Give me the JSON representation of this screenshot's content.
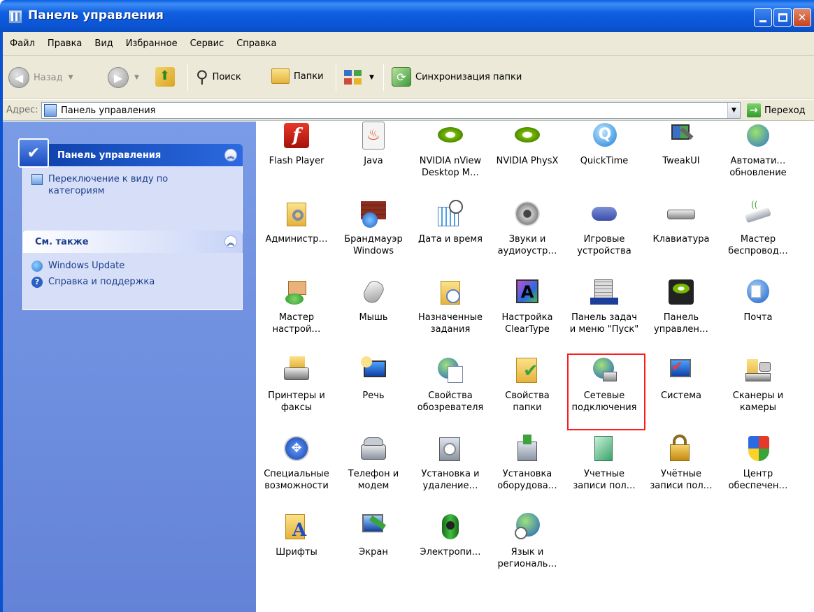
{
  "window": {
    "title": "Панель управления"
  },
  "menu": [
    "Файл",
    "Правка",
    "Вид",
    "Избранное",
    "Сервис",
    "Справка"
  ],
  "toolbar": {
    "back": "Назад",
    "search": "Поиск",
    "folders": "Папки",
    "sync": "Синхронизация папки"
  },
  "address": {
    "label": "Адрес:",
    "value": "Панель управления",
    "go": "Переход"
  },
  "sidebar": {
    "control_panel": {
      "title": "Панель управления",
      "link": "Переключение к виду по\nкатегориям"
    },
    "see_also": {
      "title": "См. также",
      "links": [
        "Windows Update",
        "Справка и поддержка"
      ]
    }
  },
  "items": [
    {
      "label": "Flash Player",
      "icon": "flash-icon"
    },
    {
      "label": "Java",
      "icon": "java-icon"
    },
    {
      "label": "NVIDIA nView\nDesktop M…",
      "icon": "nvidia-icon"
    },
    {
      "label": "NVIDIA PhysX",
      "icon": "nvidia-icon"
    },
    {
      "label": "QuickTime",
      "icon": "quicktime-icon"
    },
    {
      "label": "TweakUI",
      "icon": "tweakui-icon"
    },
    {
      "label": "Автомати…\nобновление",
      "icon": "update-icon"
    },
    {
      "label": "Администр…",
      "icon": "admin-icon"
    },
    {
      "label": "Брандмауэр\nWindows",
      "icon": "firewall-icon"
    },
    {
      "label": "Дата и время",
      "icon": "datetime-icon"
    },
    {
      "label": "Звуки и\nаудиоустр…",
      "icon": "sound-icon"
    },
    {
      "label": "Игровые\nустройства",
      "icon": "gamepad-icon"
    },
    {
      "label": "Клавиатура",
      "icon": "keyboard-icon"
    },
    {
      "label": "Мастер\nбеспровод…",
      "icon": "wireless-icon"
    },
    {
      "label": "Мастер\nнастрой…",
      "icon": "home-network-icon"
    },
    {
      "label": "Мышь",
      "icon": "mouse-icon"
    },
    {
      "label": "Назначенные\nзадания",
      "icon": "scheduled-tasks-icon"
    },
    {
      "label": "Настройка\nClearType",
      "icon": "cleartype-icon"
    },
    {
      "label": "Панель задач\nи меню \"Пуск\"",
      "icon": "taskbar-icon"
    },
    {
      "label": "Панель\nуправлен…",
      "icon": "nvidia-panel-icon"
    },
    {
      "label": "Почта",
      "icon": "mail-icon"
    },
    {
      "label": "Принтеры и\nфаксы",
      "icon": "printer-icon"
    },
    {
      "label": "Речь",
      "icon": "speech-icon"
    },
    {
      "label": "Свойства\nобозревателя",
      "icon": "internet-options-icon"
    },
    {
      "label": "Свойства\nпапки",
      "icon": "folder-options-icon"
    },
    {
      "label": "Сетевые\nподключения",
      "icon": "network-icon",
      "selected": true
    },
    {
      "label": "Система",
      "icon": "system-icon"
    },
    {
      "label": "Сканеры и\nкамеры",
      "icon": "scanner-icon"
    },
    {
      "label": "Специальные\nвозможности",
      "icon": "accessibility-icon"
    },
    {
      "label": "Телефон и\nмодем",
      "icon": "phone-icon"
    },
    {
      "label": "Установка и\nудаление…",
      "icon": "add-remove-icon"
    },
    {
      "label": "Установка\nоборудова…",
      "icon": "hardware-icon"
    },
    {
      "label": "Учетные\nзаписи пол…",
      "icon": "user-accounts-icon"
    },
    {
      "label": "Учётные\nзаписи пол…",
      "icon": "user-accounts-lock-icon"
    },
    {
      "label": "Центр\nобеспечен…",
      "icon": "security-center-icon"
    },
    {
      "label": "Шрифты",
      "icon": "fonts-icon"
    },
    {
      "label": "Экран",
      "icon": "display-icon"
    },
    {
      "label": "Электропи…",
      "icon": "power-icon"
    },
    {
      "label": "Язык и\nрегиональ…",
      "icon": "regional-icon"
    }
  ],
  "colors": {
    "titlebar": "#0c55d4",
    "selection_border": "#ff1a1a",
    "sidebar_bg": "#6f8fe0"
  }
}
